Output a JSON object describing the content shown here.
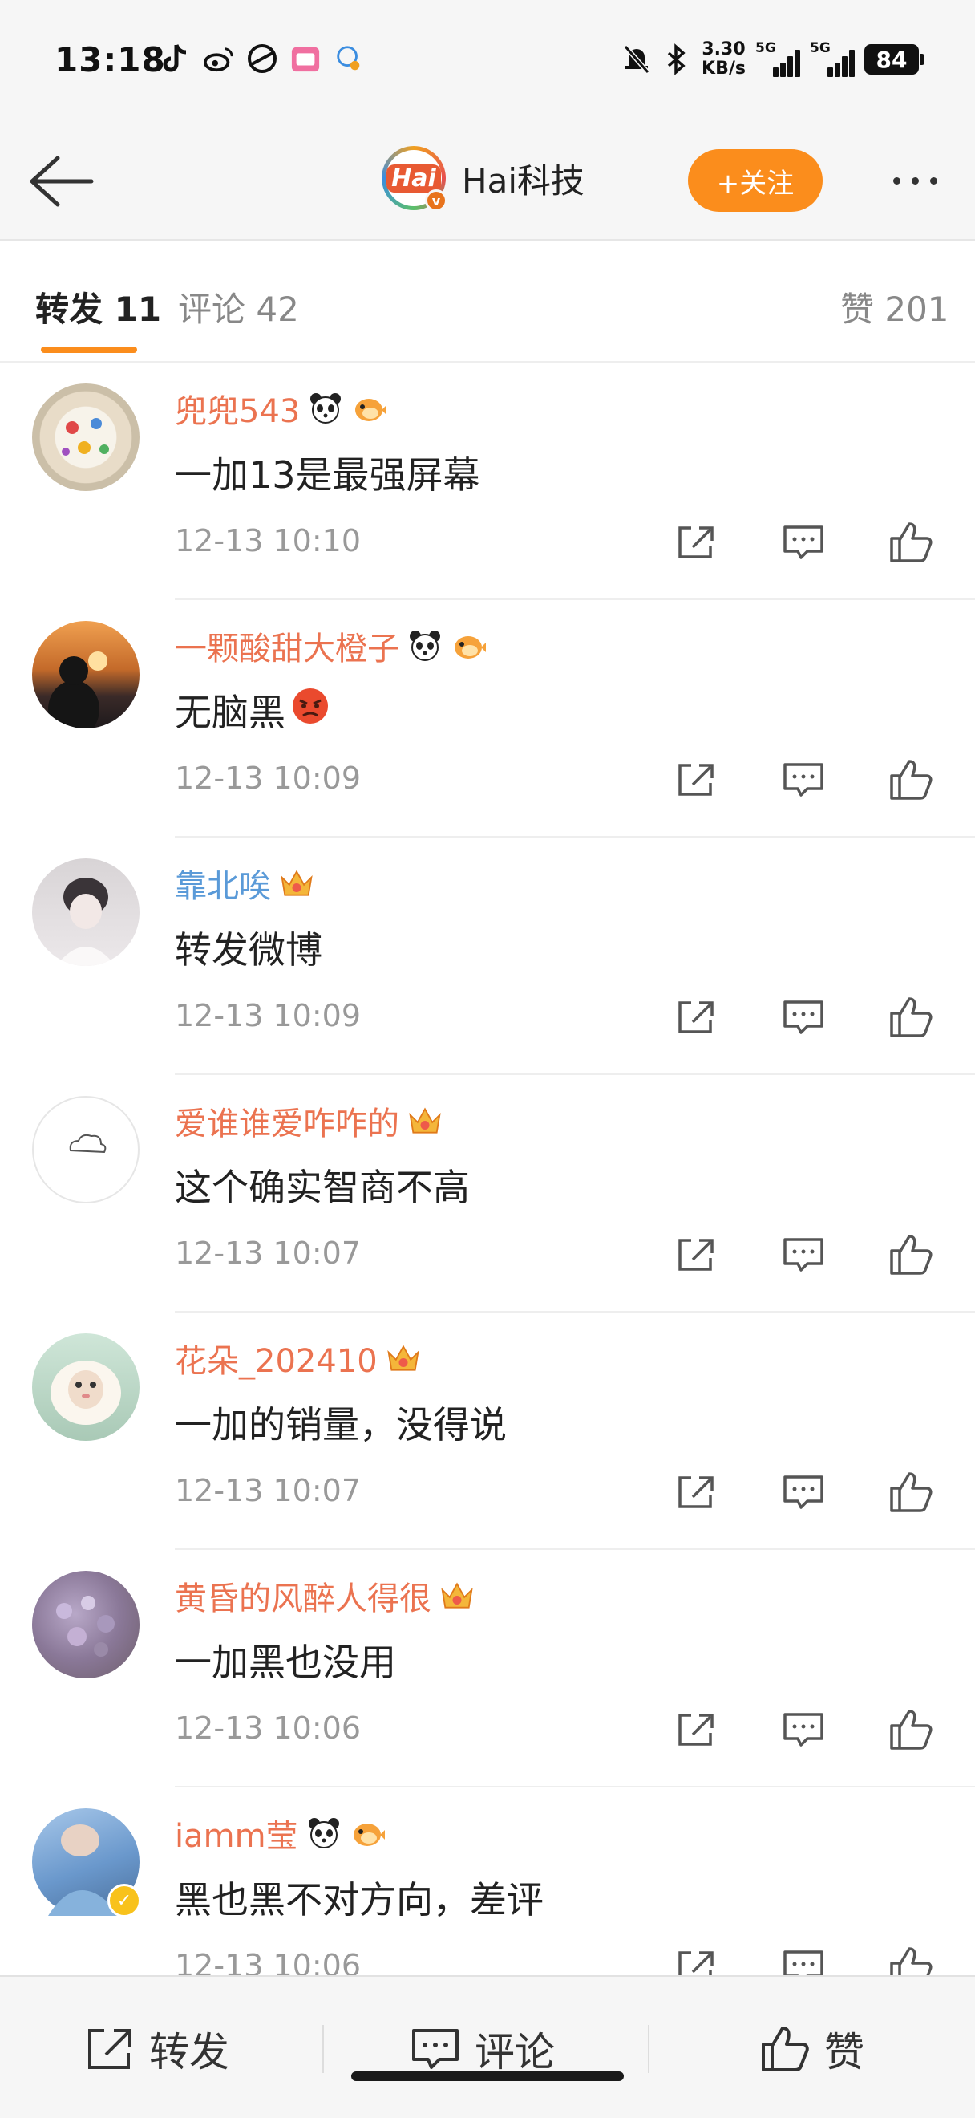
{
  "status_bar": {
    "time": "13:18",
    "net_speed_top": "3.30",
    "net_speed_bottom": "KB/s",
    "sim1": "5G",
    "sim2": "5G",
    "battery": "84"
  },
  "header": {
    "account_name": "Hai科技",
    "avatar_text": "Hai",
    "verified_badge": "v",
    "follow_label": "+关注"
  },
  "tabs": {
    "repost": "转发 11",
    "comment": "评论 42",
    "like": "赞 201"
  },
  "comments": [
    {
      "user": "兜兜543",
      "name_color": "#eb7350",
      "content": "一加13是最强屏幕",
      "time": "12-13 10:10",
      "badges": [
        "panda-icon",
        "pufferfish-icon"
      ]
    },
    {
      "user": "一颗酸甜大橙子",
      "name_color": "#eb7350",
      "content": "无脑黑",
      "time": "12-13 10:09",
      "badges": [
        "panda-icon",
        "pufferfish-icon"
      ],
      "emoji": "angry-face-emoji"
    },
    {
      "user": "靠北唉",
      "name_color": "#5a9ad8",
      "content": "转发微博",
      "time": "12-13 10:09",
      "badges": [
        "crown-icon"
      ]
    },
    {
      "user": "爱谁谁爱咋咋的",
      "name_color": "#eb7350",
      "content": "这个确实智商不高",
      "time": "12-13 10:07",
      "badges": [
        "crown-icon"
      ]
    },
    {
      "user": "花朵_202410",
      "name_color": "#eb7350",
      "content": "一加的销量，没得说",
      "time": "12-13 10:07",
      "badges": [
        "crown-icon"
      ]
    },
    {
      "user": "黄昏的风醉人得很",
      "name_color": "#eb7350",
      "content": "一加黑也没用",
      "time": "12-13 10:06",
      "badges": [
        "crown-icon"
      ]
    },
    {
      "user": "iamm莹",
      "name_color": "#eb7350",
      "content": "黑也黑不对方向，差评",
      "time": "12-13 10:06",
      "badges": [
        "panda-icon",
        "pufferfish-icon"
      ]
    }
  ],
  "bottom_bar": {
    "repost": "转发",
    "comment": "评论",
    "like": "赞"
  },
  "colors": {
    "accent_orange": "#fb8d1c",
    "username_orange": "#eb7350",
    "username_blue": "#5a9ad8"
  }
}
